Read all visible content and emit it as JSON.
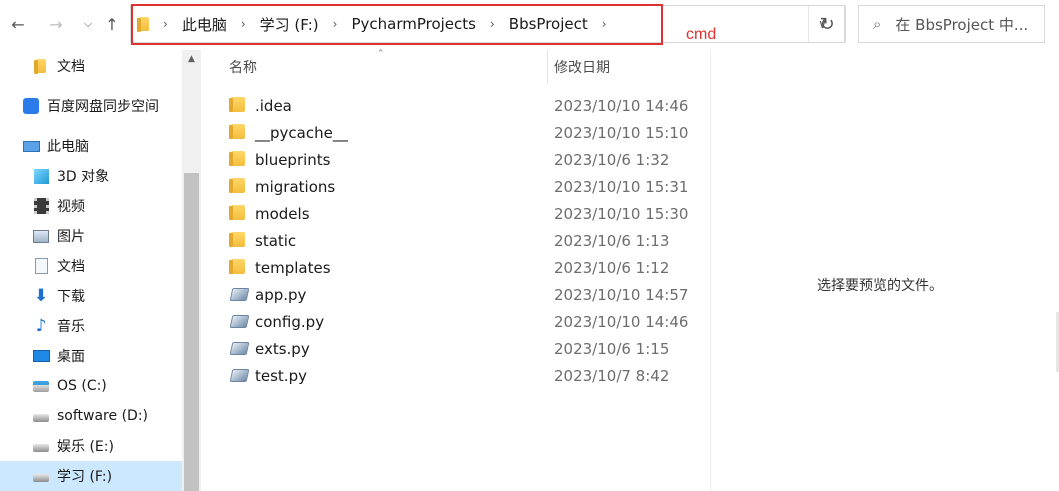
{
  "nav": {
    "back_icon": "arrow-left-icon",
    "forward_icon": "arrow-right-icon",
    "recent_icon": "chevron-down-icon",
    "up_icon": "arrow-up-icon"
  },
  "address": {
    "crumbs": [
      "此电脑",
      "学习 (F:)",
      "PycharmProjects",
      "BbsProject"
    ]
  },
  "annotation": {
    "label": "cmd",
    "color": "#e03131"
  },
  "search": {
    "placeholder": "在 BbsProject 中..."
  },
  "sidebar": {
    "items": [
      {
        "label": "文档",
        "icon": "folder-icon"
      },
      {
        "label": "百度网盘同步空间",
        "icon": "baidu-netdisk-icon"
      },
      {
        "label": "此电脑",
        "icon": "computer-icon"
      },
      {
        "label": "3D 对象",
        "icon": "3d-objects-icon"
      },
      {
        "label": "视频",
        "icon": "video-icon"
      },
      {
        "label": "图片",
        "icon": "pictures-icon"
      },
      {
        "label": "文档",
        "icon": "documents-icon"
      },
      {
        "label": "下载",
        "icon": "download-icon"
      },
      {
        "label": "音乐",
        "icon": "music-icon"
      },
      {
        "label": "桌面",
        "icon": "desktop-icon"
      },
      {
        "label": "OS (C:)",
        "icon": "windows-drive-icon"
      },
      {
        "label": "software (D:)",
        "icon": "drive-icon"
      },
      {
        "label": "娱乐 (E:)",
        "icon": "drive-icon"
      },
      {
        "label": "学习 (F:)",
        "icon": "drive-icon"
      }
    ]
  },
  "columns": {
    "name": "名称",
    "date": "修改日期"
  },
  "files": [
    {
      "name": ".idea",
      "date": "2023/10/10 14:46",
      "type": "folder"
    },
    {
      "name": "__pycache__",
      "date": "2023/10/10 15:10",
      "type": "folder"
    },
    {
      "name": "blueprints",
      "date": "2023/10/6 1:32",
      "type": "folder"
    },
    {
      "name": "migrations",
      "date": "2023/10/10 15:31",
      "type": "folder"
    },
    {
      "name": "models",
      "date": "2023/10/10 15:30",
      "type": "folder"
    },
    {
      "name": "static",
      "date": "2023/10/6 1:13",
      "type": "folder"
    },
    {
      "name": "templates",
      "date": "2023/10/6 1:12",
      "type": "folder"
    },
    {
      "name": "app.py",
      "date": "2023/10/10 14:57",
      "type": "python"
    },
    {
      "name": "config.py",
      "date": "2023/10/10 14:46",
      "type": "python"
    },
    {
      "name": "exts.py",
      "date": "2023/10/6 1:15",
      "type": "python"
    },
    {
      "name": "test.py",
      "date": "2023/10/7 8:42",
      "type": "python"
    }
  ],
  "preview": {
    "message": "选择要预览的文件。"
  }
}
